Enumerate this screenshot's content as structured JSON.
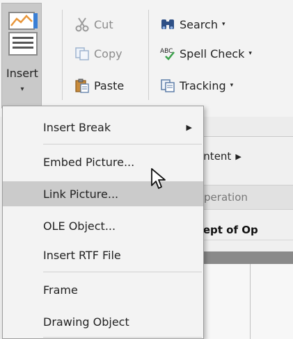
{
  "ribbon": {
    "insert_label": "Insert",
    "insert_dropdown_glyph": "▾",
    "clipboard": {
      "cut_label": "Cut",
      "copy_label": "Copy",
      "paste_label": "Paste"
    },
    "tools": {
      "search_label": "Search",
      "spell_check_label": "Spell Check",
      "tracking_label": "Tracking",
      "dropdown_glyph": "▾"
    },
    "icons": [
      "insert-picture-icon",
      "scissors-icon",
      "copy-icon",
      "paste-icon",
      "binoculars-icon",
      "spell-check-icon",
      "tracking-icon"
    ]
  },
  "menu": {
    "items": [
      {
        "label": "Insert Break",
        "submenu": true,
        "sub_glyph": "▶"
      },
      {
        "label": "Embed Picture...",
        "submenu": false
      },
      {
        "label": "Link Picture...",
        "submenu": false,
        "highlighted": true
      },
      {
        "label": "OLE Object...",
        "submenu": false
      },
      {
        "label": "Insert RTF File",
        "submenu": false
      },
      {
        "label": "Frame",
        "submenu": false
      },
      {
        "label": "Drawing Object",
        "submenu": false
      }
    ]
  },
  "background": {
    "content_fragment": "t Content",
    "content_arrow": "▶",
    "tab_fragment": "of Operation",
    "heading_fragment": "oncept of Op"
  },
  "colors": {
    "ribbon_bg": "#f3f3f3",
    "menu_bg": "#f3f3f3",
    "menu_highlight": "#cbcbcb",
    "insert_pressed": "#c9c9c9"
  }
}
